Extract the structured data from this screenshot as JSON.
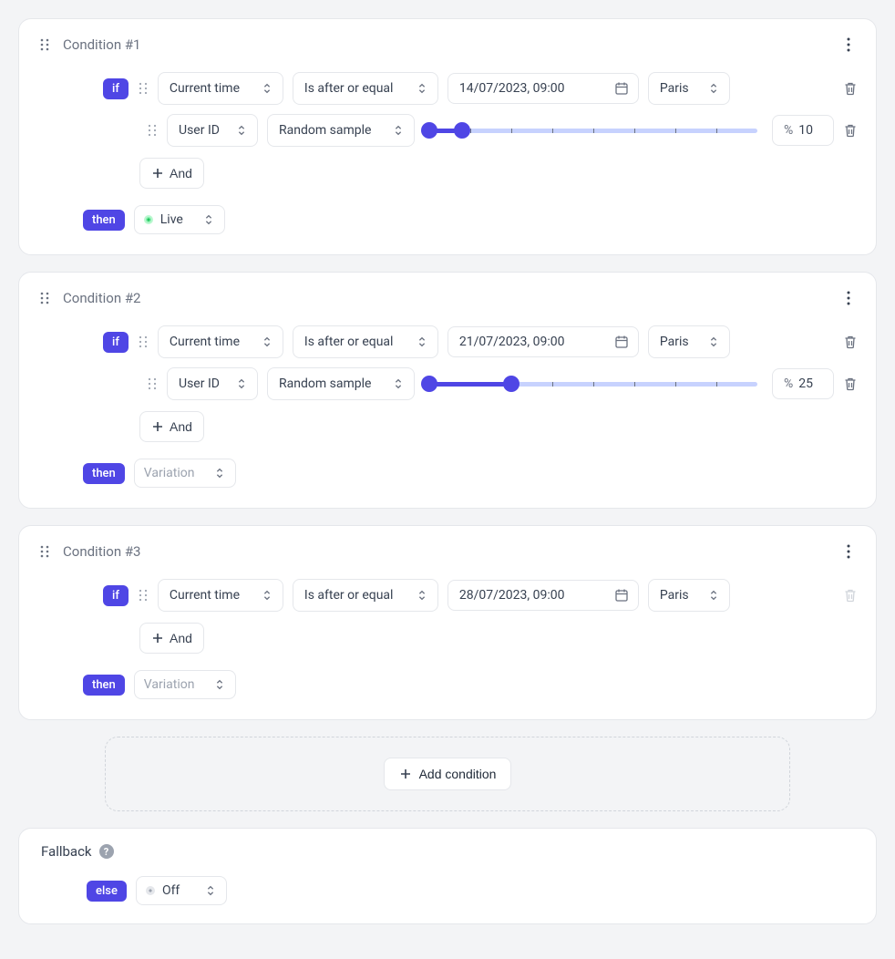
{
  "labels": {
    "if": "if",
    "then": "then",
    "else": "else",
    "and": "And",
    "add_condition": "Add condition",
    "fallback": "Fallback",
    "percent_symbol": "%"
  },
  "statuses": {
    "live": "Live",
    "off": "Off",
    "variation_placeholder": "Variation"
  },
  "conditions": [
    {
      "title": "Condition #1",
      "then_status": "live",
      "then_label": "Live",
      "rules": [
        {
          "type": "time",
          "field": "Current time",
          "operator": "Is after or equal",
          "datetime": "14/07/2023, 09:00",
          "timezone": "Paris",
          "deletable": true
        },
        {
          "type": "sample",
          "field": "User ID",
          "operator": "Random sample",
          "percent": "10",
          "slider_low": 0,
          "slider_high": 10,
          "deletable": true
        }
      ]
    },
    {
      "title": "Condition #2",
      "then_status": "variation",
      "then_label": "Variation",
      "rules": [
        {
          "type": "time",
          "field": "Current time",
          "operator": "Is after or equal",
          "datetime": "21/07/2023, 09:00",
          "timezone": "Paris",
          "deletable": true
        },
        {
          "type": "sample",
          "field": "User ID",
          "operator": "Random sample",
          "percent": "25",
          "slider_low": 0,
          "slider_high": 25,
          "deletable": true
        }
      ]
    },
    {
      "title": "Condition #3",
      "then_status": "variation",
      "then_label": "Variation",
      "rules": [
        {
          "type": "time",
          "field": "Current time",
          "operator": "Is after or equal",
          "datetime": "28/07/2023, 09:00",
          "timezone": "Paris",
          "deletable": false
        }
      ]
    }
  ],
  "fallback": {
    "status": "off",
    "label": "Off"
  }
}
